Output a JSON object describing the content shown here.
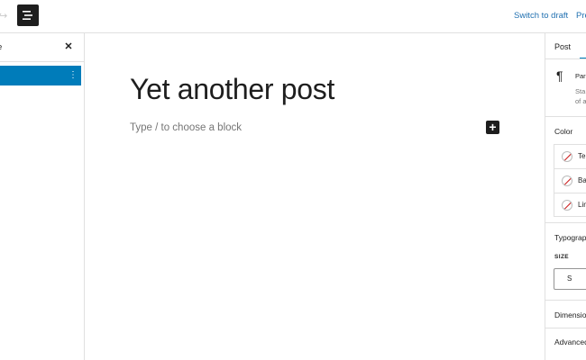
{
  "topbar": {
    "switch_to_draft": "Switch to draft",
    "preview": "Pre",
    "list_view_icon": "list-view-icon",
    "redo_icon": "redo-icon"
  },
  "left_panel": {
    "title": "e",
    "close_icon": "close-icon",
    "selected_item_menu": "⋮"
  },
  "editor": {
    "post_title": "Yet another post",
    "block_placeholder": "Type / to choose a block",
    "add_block_icon": "plus-icon",
    "add_block_symbol": "+"
  },
  "sidebar": {
    "tab_post": "Post",
    "block_icon": "¶",
    "block_name": "Par",
    "block_desc_line1": "Sta",
    "block_desc_line2": "of a",
    "color_title": "Color",
    "color_items": [
      "Te",
      "Ba",
      "Lin"
    ],
    "typography_title": "Typograp",
    "size_label": "SIZE",
    "size_value": "S",
    "dimensions_title": "Dimensio",
    "advanced_title": "Advanced"
  },
  "colors": {
    "accent": "#007cba",
    "link": "#2271b1",
    "dark": "#1e1e1e",
    "border": "#e0e0e0"
  }
}
